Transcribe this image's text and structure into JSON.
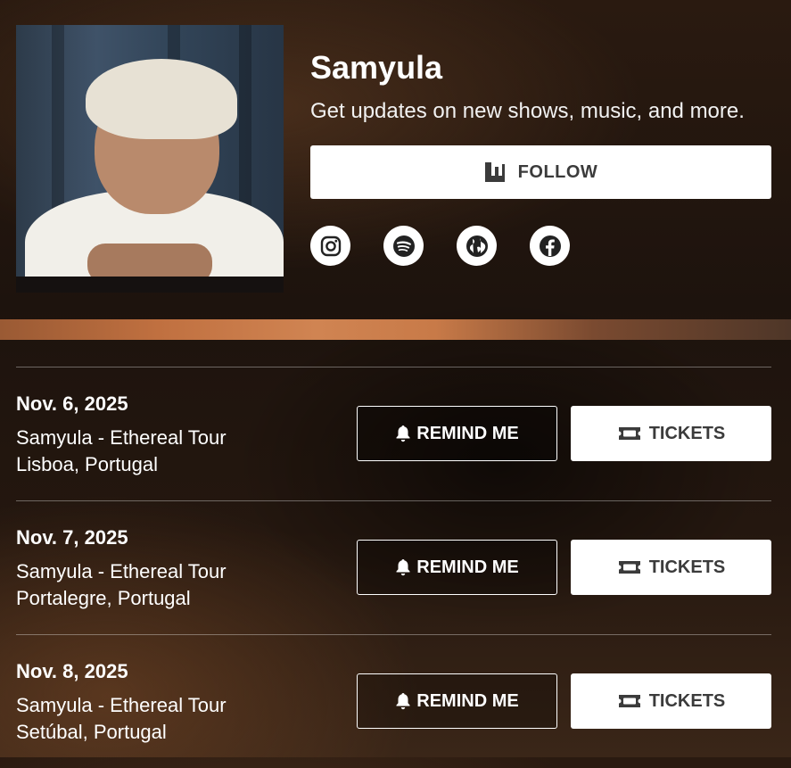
{
  "artist": {
    "name": "Samyula",
    "tagline": "Get updates on new shows, music, and more.",
    "follow_label": "FOLLOW"
  },
  "socials": [
    {
      "icon": "instagram-icon"
    },
    {
      "icon": "spotify-icon"
    },
    {
      "icon": "globe-icon"
    },
    {
      "icon": "facebook-icon"
    }
  ],
  "events": [
    {
      "date": "Nov. 6, 2025",
      "title": "Samyula - Ethereal Tour",
      "location": "Lisboa, Portugal",
      "remind_label": "REMIND ME",
      "tickets_label": "TICKETS"
    },
    {
      "date": "Nov. 7, 2025",
      "title": "Samyula - Ethereal Tour",
      "location": "Portalegre, Portugal",
      "remind_label": "REMIND ME",
      "tickets_label": "TICKETS"
    },
    {
      "date": "Nov. 8, 2025",
      "title": "Samyula - Ethereal Tour",
      "location": "Setúbal, Portugal",
      "remind_label": "REMIND ME",
      "tickets_label": "TICKETS"
    }
  ],
  "colors": {
    "button_bg": "#ffffff",
    "button_text": "#3b3b3b",
    "accent_band": "#c07040"
  }
}
